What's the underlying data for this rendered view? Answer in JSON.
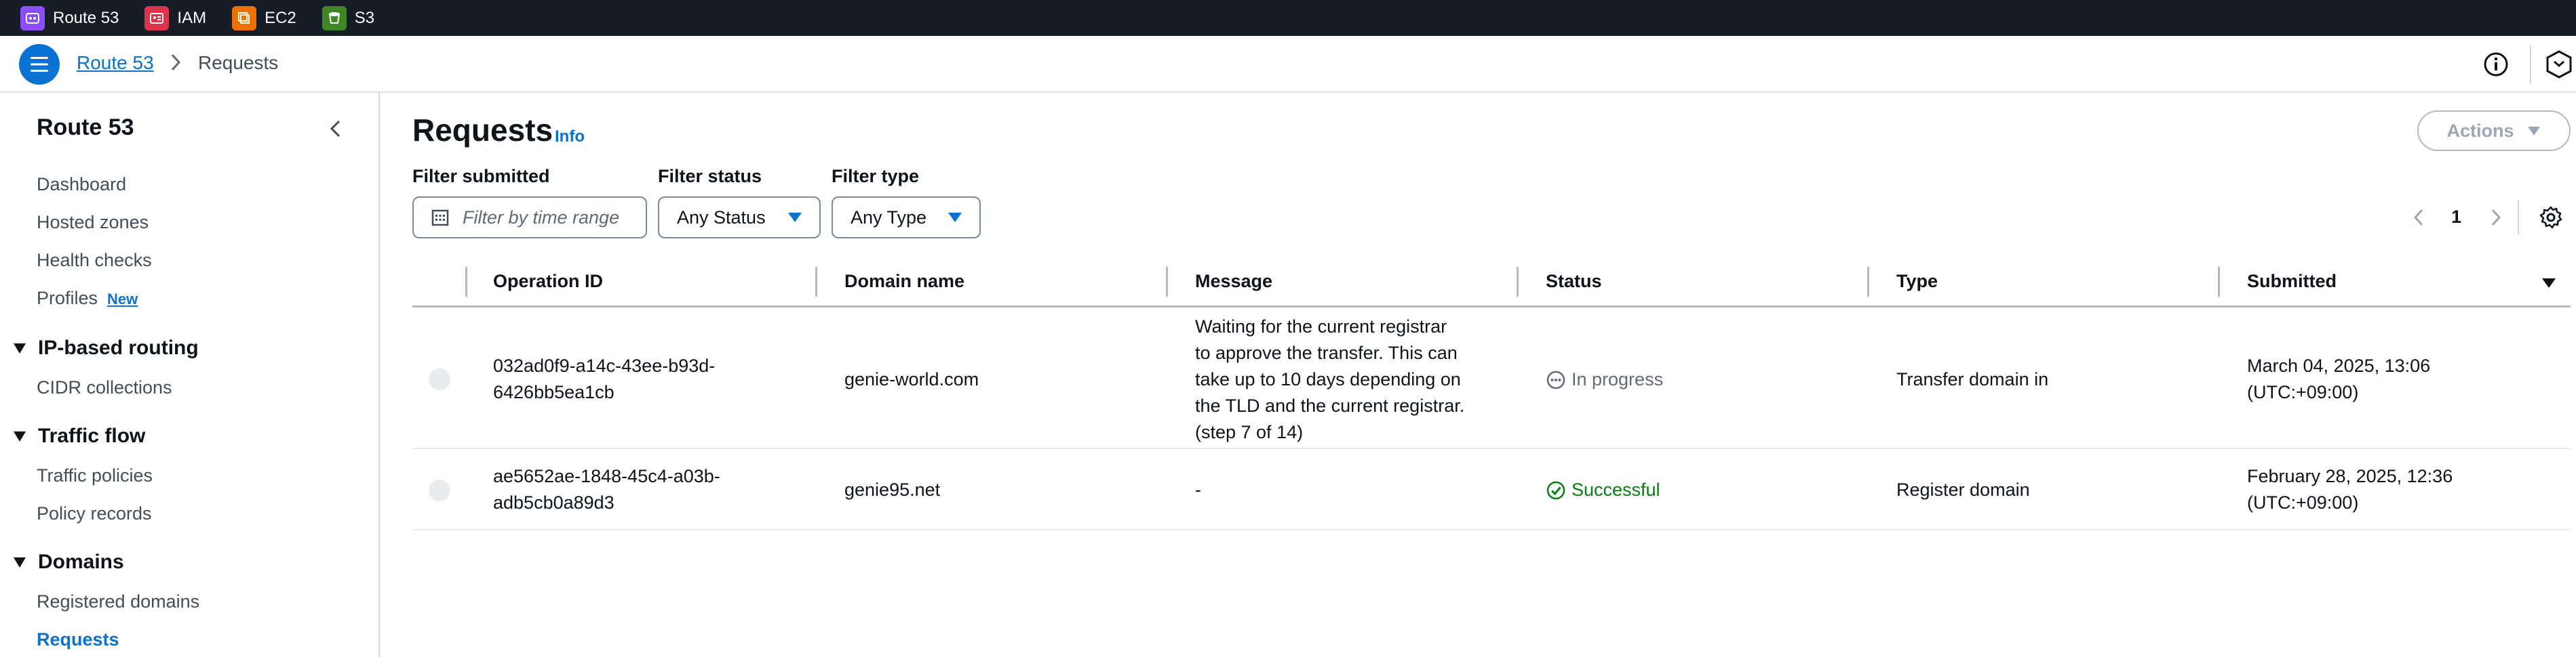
{
  "services": [
    {
      "label": "Route 53",
      "color": "#8c4fff",
      "icon": "route53-icon"
    },
    {
      "label": "IAM",
      "color": "#dd344c",
      "icon": "iam-icon"
    },
    {
      "label": "EC2",
      "color": "#ed7100",
      "icon": "ec2-icon"
    },
    {
      "label": "S3",
      "color": "#3f8624",
      "icon": "s3-icon"
    }
  ],
  "breadcrumb": {
    "root": "Route 53",
    "current": "Requests"
  },
  "sidebar": {
    "title": "Route 53",
    "items": {
      "dashboard": "Dashboard",
      "hosted_zones": "Hosted zones",
      "health_checks": "Health checks",
      "profiles": "Profiles",
      "profiles_badge": "New"
    },
    "sections": {
      "ip_routing": {
        "title": "IP-based routing",
        "items": [
          "CIDR collections"
        ]
      },
      "traffic_flow": {
        "title": "Traffic flow",
        "items": [
          "Traffic policies",
          "Policy records"
        ]
      },
      "domains": {
        "title": "Domains",
        "items": [
          "Registered domains",
          "Requests"
        ]
      }
    }
  },
  "main": {
    "title": "Requests",
    "info": "Info",
    "actions": "Actions",
    "filters": {
      "submitted_label": "Filter submitted",
      "submitted_placeholder": "Filter by time range",
      "status_label": "Filter status",
      "status_value": "Any Status",
      "type_label": "Filter type",
      "type_value": "Any Type"
    },
    "pagination": {
      "page": "1"
    }
  },
  "table": {
    "columns": [
      "Operation ID",
      "Domain name",
      "Message",
      "Status",
      "Type",
      "Submitted"
    ],
    "rows": [
      {
        "operation_id": [
          "032ad0f9-a14c-43ee-b93d-",
          "6426bb5ea1cb"
        ],
        "domain": "genie-world.com",
        "message": [
          "Waiting for the current registrar",
          "to approve the transfer. This can",
          "take up to 10 days depending on",
          "the TLD and the current registrar.",
          "(step 7 of 14)"
        ],
        "status": "In progress",
        "type": "Transfer domain in",
        "submitted": [
          "March 04, 2025, 13:06",
          "(UTC:+09:00)"
        ]
      },
      {
        "operation_id": [
          "ae5652ae-1848-45c4-a03b-",
          "adb5cb0a89d3"
        ],
        "domain": "genie95.net",
        "message": [
          "-"
        ],
        "status": "Successful",
        "type": "Register domain",
        "submitted": [
          "February 28, 2025, 12:36",
          "(UTC:+09:00)"
        ]
      }
    ]
  },
  "colors": {
    "link": "#0972d3",
    "success": "#037f0c",
    "topbar": "#161d26"
  }
}
